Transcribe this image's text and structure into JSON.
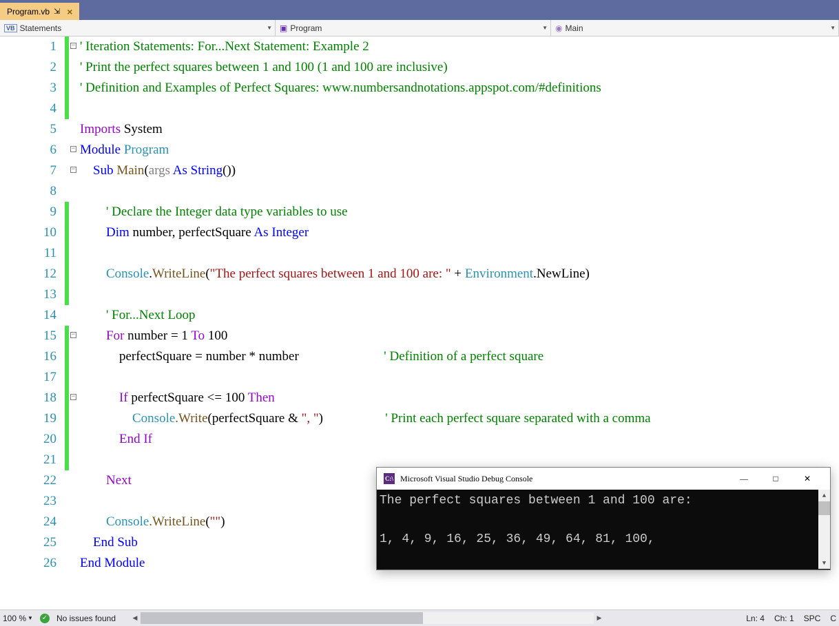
{
  "tab": {
    "label": "Program.vb",
    "pin": "⇲",
    "close": "×"
  },
  "nav": {
    "scope1": "Statements",
    "scope2": "Program",
    "scope3": "Main"
  },
  "lines": [
    "1",
    "2",
    "3",
    "4",
    "5",
    "6",
    "7",
    "8",
    "9",
    "10",
    "11",
    "12",
    "13",
    "14",
    "15",
    "16",
    "17",
    "18",
    "19",
    "20",
    "21",
    "22",
    "23",
    "24",
    "25",
    "26"
  ],
  "code": {
    "l1a": "' Iteration Statements: For...Next Statement: Example 2",
    "l2a": "' Print the perfect squares between 1 and 100 (1 and 100 are inclusive)",
    "l3a": "' Definition and Examples of Perfect Squares: www.numbersandnotations.appspot.com/#definitions",
    "l5_imports": "Imports",
    "l5_system": " System",
    "l6_module": "Module",
    "l6_program": " Program",
    "l7_sub": "Sub",
    "l7_main": " Main",
    "l7_p1": "(",
    "l7_args": "args",
    "l7_as": " As ",
    "l7_string": "String",
    "l7_p2": "())",
    "l9": "' Declare the Integer data type variables to use",
    "l10_dim": "Dim",
    "l10_vars": " number, perfectSquare ",
    "l10_as": "As ",
    "l10_int": "Integer",
    "l12_con": "Console",
    "l12_dot": ".",
    "l12_wl": "WriteLine",
    "l12_p1": "(",
    "l12_str": "\"The perfect squares between 1 and 100 are: \"",
    "l12_plus": " + ",
    "l12_env": "Environment",
    "l12_nl": ".NewLine",
    "l12_p2": ")",
    "l14": "' For...Next Loop",
    "l15_for": "For",
    "l15_body": " number = 1 ",
    "l15_to": "To",
    "l15_100": " 100",
    "l16_body": "perfectSquare = number * number",
    "l16_cmt": "' Definition of a perfect square",
    "l18_if": "If",
    "l18_cond": " perfectSquare <= 100 ",
    "l18_then": "Then",
    "l19_con": "Console",
    "l19_w": ".Write",
    "l19_p1": "(",
    "l19_arg": "perfectSquare & ",
    "l19_str": "\", \"",
    "l19_p2": ")",
    "l19_cmt": "' Print each perfect square separated with a comma",
    "l20_endif": "End If",
    "l22_next": "Next",
    "l24_con": "Console",
    "l24_wl": ".WriteLine",
    "l24_p": "(",
    "l24_str": "\"\"",
    "l24_p2": ")",
    "l25": "End Sub",
    "l26": "End Module"
  },
  "console": {
    "title": "Microsoft Visual Studio Debug Console",
    "line1": "The perfect squares between 1 and 100 are:",
    "line2": "1, 4, 9, 16, 25, 36, 49, 64, 81, 100,"
  },
  "status": {
    "zoom": "100 %",
    "issues": "No issues found",
    "ln": "Ln: 4",
    "ch": "Ch: 1",
    "spc": "SPC",
    "crlf": "C"
  }
}
